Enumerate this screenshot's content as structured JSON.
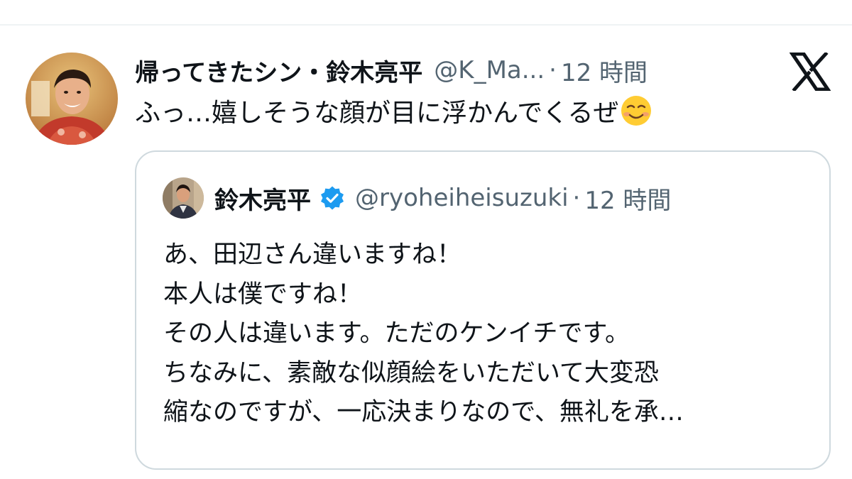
{
  "post": {
    "display_name": "帰ってきたシン・鈴木亮平",
    "handle": "@K_Ma...",
    "separator": "·",
    "time": "12 時間",
    "text": "ふっ…嬉しそうな顔が目に浮かんでくるぜ",
    "emoji": "smiling-face-emoji",
    "brand_icon": "x-logo-icon"
  },
  "quote": {
    "display_name": "鈴木亮平",
    "verified_icon": "verified-badge-icon",
    "verified_color": "#1d9bf0",
    "handle": "@ryoheiheisuzuki",
    "separator": "·",
    "time": "12 時間",
    "lines": [
      "あ、田辺さん違いますね！",
      "本人は僕ですね！",
      "その人は違います。ただのケンイチです。",
      "ちなみに、素敵な似顔絵をいただいて大変恐",
      "縮なのですが、一応決まりなので、無礼を承…"
    ]
  },
  "colors": {
    "text_primary": "#0f1419",
    "text_secondary": "#536471",
    "border": "#cfd9de"
  }
}
